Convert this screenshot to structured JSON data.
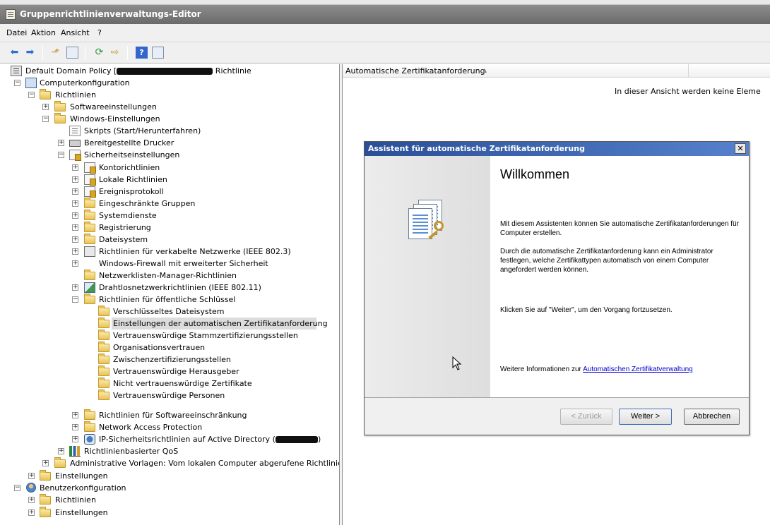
{
  "window": {
    "title": "Gruppenrichtlinienverwaltungs-Editor"
  },
  "menu": [
    "Datei",
    "Aktion",
    "Ansicht",
    "?"
  ],
  "toolbar": {
    "help_glyph": "?"
  },
  "tree": {
    "root_label": "Default Domain Policy [",
    "root_suffix": " Richtlinie",
    "computer": "Computerkonfiguration",
    "richtlinien": "Richtlinien",
    "softwareeinstellungen": "Softwareeinstellungen",
    "windows_einstellungen": "Windows-Einstellungen",
    "skripts": "Skripts (Start/Herunterfahren)",
    "drucker": "Bereitgestellte Drucker",
    "sicherheit": "Sicherheitseinstellungen",
    "sec_items": [
      "Kontorichtlinien",
      "Lokale Richtlinien",
      "Ereignisprotokoll",
      "Eingeschränkte Gruppen",
      "Systemdienste",
      "Registrierung",
      "Dateisystem",
      "Richtlinien für verkabelte Netzwerke (IEEE 802.3)",
      "Windows-Firewall mit erweiterter Sicherheit",
      "Netzwerklisten-Manager-Richtlinien",
      "Drahtlosnetzwerkrichtlinien (IEEE 802.11)",
      "Richtlinien für öffentliche Schlüssel"
    ],
    "pk_items": [
      "Verschlüsseltes Dateisystem",
      "Einstellungen der automatischen Zertifikatanforderung",
      "Vertrauenswürdige Stammzertifizierungsstellen",
      "Organisationsvertrauen",
      "Zwischenzertifizierungsstellen",
      "Vertrauenswürdige Herausgeber",
      "Nicht vertrauenswürdige Zertifikate",
      "Vertrauenswürdige Personen"
    ],
    "sec_tail": [
      "Richtlinien für Softwareeinschränkung",
      "Network Access Protection",
      "IP-Sicherheitsrichtlinien auf Active Directory ("
    ],
    "ipsec_suffix": ")",
    "qos": "Richtlinienbasierter QoS",
    "admin_vorlagen": "Administrative Vorlagen: Vom lokalen Computer abgerufene Richtliniende",
    "einstellungen": "Einstellungen",
    "benutzer": "Benutzerkonfiguration",
    "user_items": [
      "Richtlinien",
      "Einstellungen"
    ]
  },
  "list": {
    "column": "Automatische Zertifikatanforderung",
    "empty_message": "In dieser Ansicht werden keine Eleme"
  },
  "dialog": {
    "title": "Assistent für automatische Zertifikatanforderung",
    "close_glyph": "✕",
    "heading": "Willkommen",
    "para1": "Mit diesem Assistenten können Sie automatische Zertifikatanforderungen für Computer erstellen.",
    "para2": "Durch die automatische Zertifikatanforderung kann ein Administrator festlegen, welche Zertifikattypen automatisch von einem Computer angefordert werden können.",
    "para3": "Klicken Sie auf \"Weiter\", um den Vorgang fortzusetzen.",
    "more_info": "Weitere Informationen zur ",
    "more_info_link": "Automatischen Zertifikatverwaltung",
    "back": "< Zurück",
    "next": "Weiter >",
    "cancel": "Abbrechen"
  },
  "icons": {
    "back": "arrow-left-icon",
    "forward": "arrow-right-icon",
    "folder": "folder-icon",
    "refresh": "refresh-icon",
    "export": "export-list-icon",
    "help": "help-icon"
  }
}
